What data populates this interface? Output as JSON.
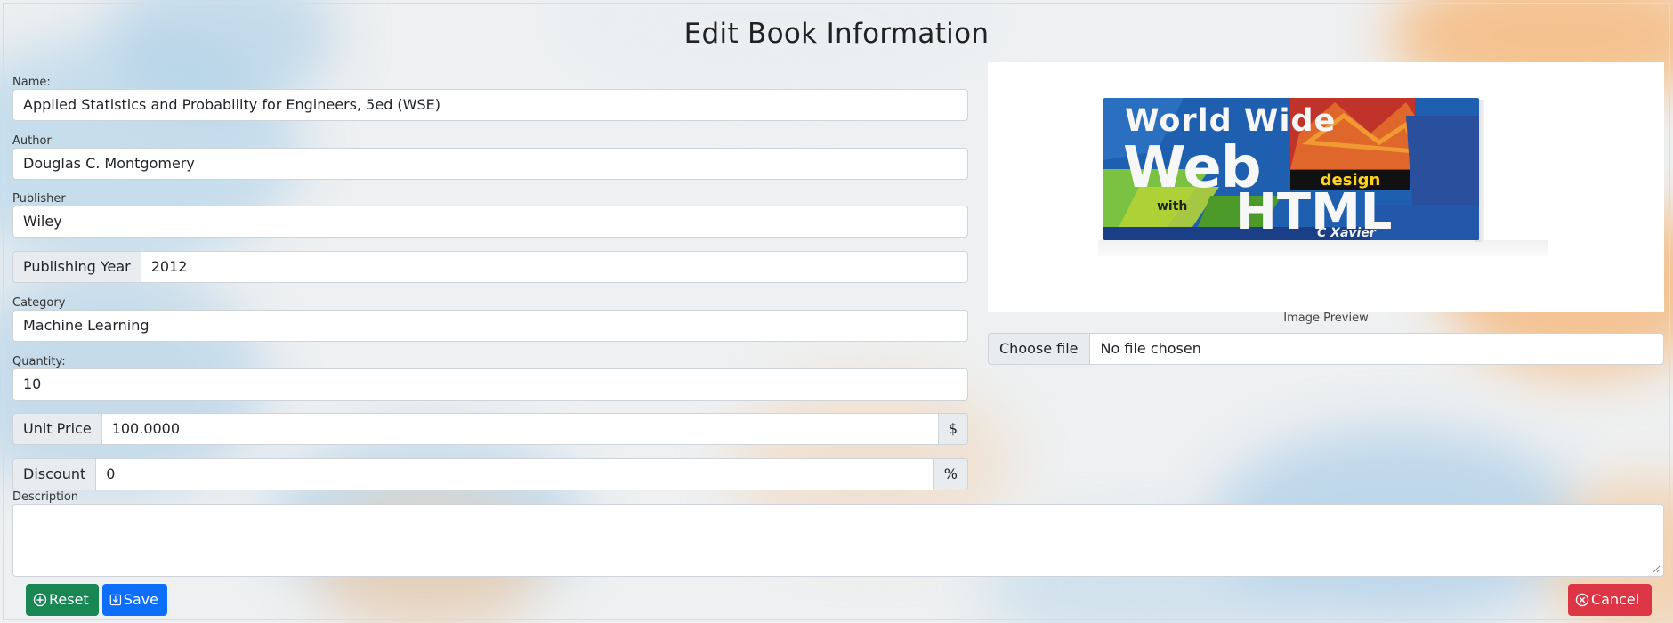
{
  "page": {
    "title": "Edit Book Information"
  },
  "form": {
    "name": {
      "label": "Name:",
      "value": "Applied Statistics and Probability for Engineers, 5ed (WSE)"
    },
    "author": {
      "label": "Author",
      "value": "Douglas C. Montgomery"
    },
    "publisher": {
      "label": "Publisher",
      "value": "Wiley"
    },
    "publishing_year": {
      "label": "Publishing Year",
      "value": "2012"
    },
    "category": {
      "label": "Category",
      "value": "Machine Learning"
    },
    "quantity": {
      "label": "Quantity:",
      "value": "10"
    },
    "unit_price": {
      "label": "Unit Price",
      "value": "100.0000",
      "suffix": "$"
    },
    "discount": {
      "label": "Discount",
      "value": "0",
      "suffix": "%"
    },
    "description": {
      "label": "Description",
      "value": ""
    }
  },
  "image": {
    "caption": "Image Preview",
    "file_button": "Choose file",
    "file_status": "No file chosen",
    "cover": {
      "line1": "World Wide",
      "line2": "Web",
      "line3": "design",
      "line4": "with",
      "line5": "HTML",
      "author": "C Xavier"
    }
  },
  "buttons": {
    "reset": "Reset",
    "save": "Save",
    "cancel": "Cancel"
  },
  "colors": {
    "reset": "#198754",
    "save": "#0d6efd",
    "cancel": "#dc3545"
  }
}
